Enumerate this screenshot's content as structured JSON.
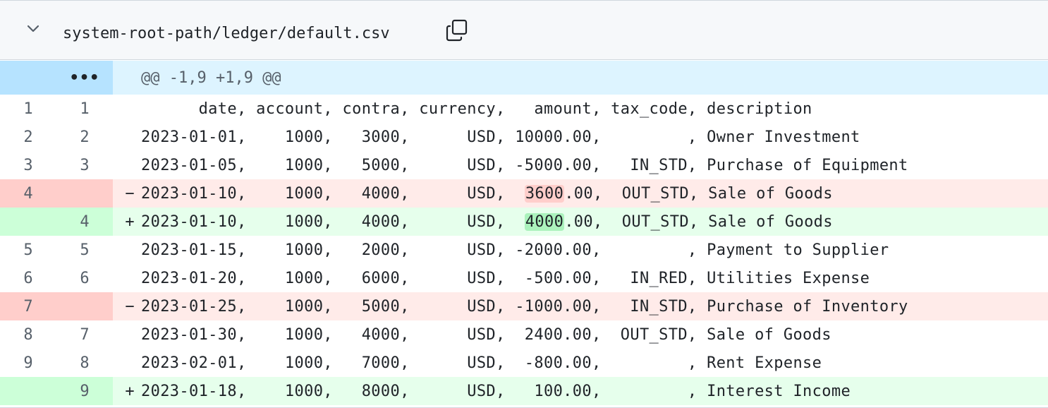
{
  "file": {
    "path": "system-root-path/ledger/default.csv",
    "collapse_icon": "chevron-down-icon",
    "copy_icon": "copy-icon"
  },
  "hunk": {
    "expand_label": "•••",
    "header": "@@ -1,9 +1,9 @@"
  },
  "lines": [
    {
      "type": "ctx",
      "old": "1",
      "new": "1",
      "marker": "",
      "text": "      date, account, contra, currency,   amount, tax_code, description"
    },
    {
      "type": "ctx",
      "old": "2",
      "new": "2",
      "marker": "",
      "text": "2023-01-01,    1000,   3000,      USD, 10000.00,         , Owner Investment"
    },
    {
      "type": "ctx",
      "old": "3",
      "new": "3",
      "marker": "",
      "text": "2023-01-05,    1000,   5000,      USD, -5000.00,   IN_STD, Purchase of Equipment"
    },
    {
      "type": "del",
      "old": "4",
      "new": "",
      "marker": "−",
      "pre": "2023-01-10,    1000,   4000,      USD,  ",
      "hl": "3600",
      "post": ".00,  OUT_STD, Sale of Goods"
    },
    {
      "type": "add",
      "old": "",
      "new": "4",
      "marker": "+",
      "pre": "2023-01-10,    1000,   4000,      USD,  ",
      "hl": "4000",
      "post": ".00,  OUT_STD, Sale of Goods"
    },
    {
      "type": "ctx",
      "old": "5",
      "new": "5",
      "marker": "",
      "text": "2023-01-15,    1000,   2000,      USD, -2000.00,         , Payment to Supplier"
    },
    {
      "type": "ctx",
      "old": "6",
      "new": "6",
      "marker": "",
      "text": "2023-01-20,    1000,   6000,      USD,  -500.00,   IN_RED, Utilities Expense"
    },
    {
      "type": "del",
      "old": "7",
      "new": "",
      "marker": "−",
      "text": "2023-01-25,    1000,   5000,      USD, -1000.00,   IN_STD, Purchase of Inventory"
    },
    {
      "type": "ctx",
      "old": "8",
      "new": "7",
      "marker": "",
      "text": "2023-01-30,    1000,   4000,      USD,  2400.00,  OUT_STD, Sale of Goods"
    },
    {
      "type": "ctx",
      "old": "9",
      "new": "8",
      "marker": "",
      "text": "2023-02-01,    1000,   7000,      USD,  -800.00,         , Rent Expense"
    },
    {
      "type": "add",
      "old": "",
      "new": "9",
      "marker": "+",
      "text": "2023-01-18,    1000,   8000,      USD,   100.00,         , Interest Income"
    }
  ]
}
